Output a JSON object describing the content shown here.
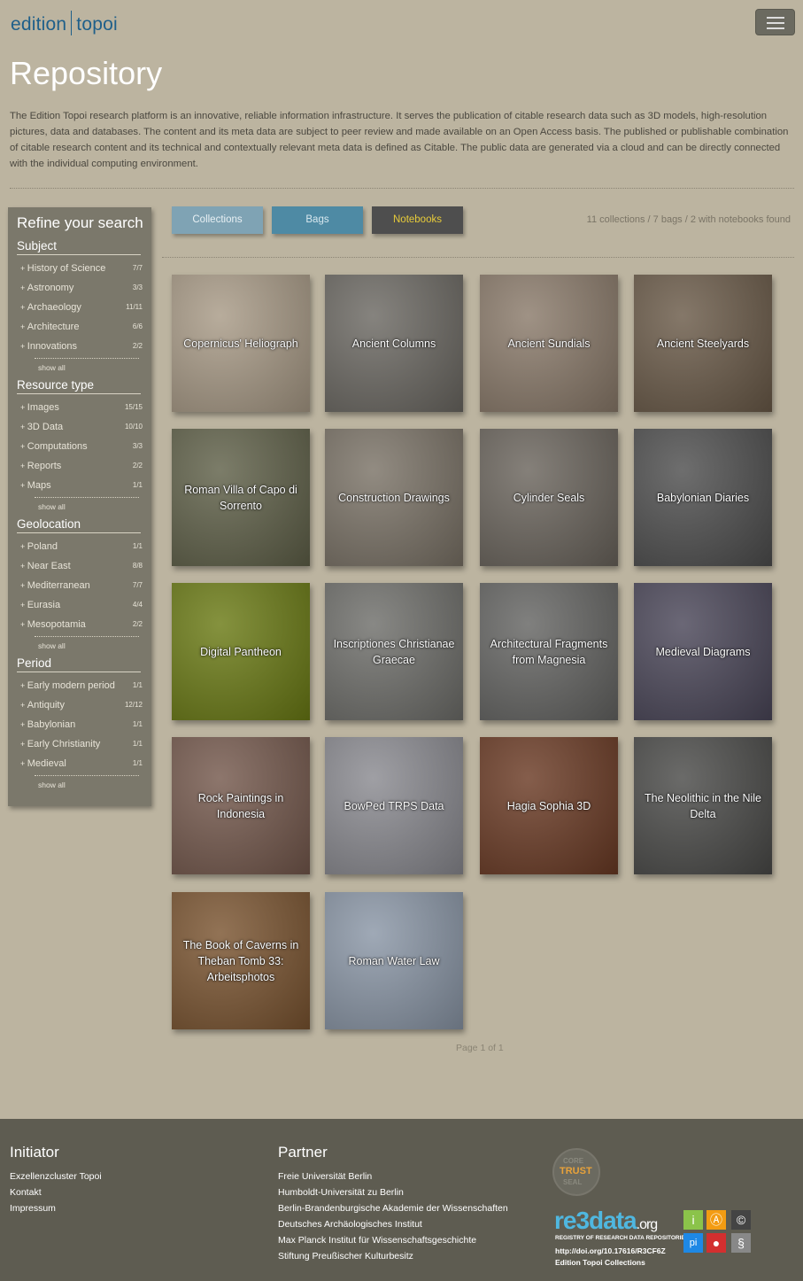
{
  "header": {
    "logo_left": "edition",
    "logo_right": "topoi",
    "menu_icon": "hamburger-icon"
  },
  "page_title": "Repository",
  "intro": "The Edition Topoi research platform is an innovative, reliable information infrastructure. It serves the publication of citable research data such as 3D models, high-resolution pictures, data and databases. The content and its meta data are subject to peer review and made available on an Open Access basis. The published or publishable combination of citable research content and its technical and contextually relevant meta data is defined as Citable. The public data are generated via a cloud and can be directly connected with the individual computing environment.",
  "sidebar": {
    "title": "Refine your search",
    "show_all": "show all",
    "facets": [
      {
        "title": "Subject",
        "items": [
          {
            "label": "History of Science",
            "count": "7/7"
          },
          {
            "label": "Astronomy",
            "count": "3/3"
          },
          {
            "label": "Archaeology",
            "count": "11/11"
          },
          {
            "label": "Architecture",
            "count": "6/6"
          },
          {
            "label": "Innovations",
            "count": "2/2"
          }
        ]
      },
      {
        "title": "Resource type",
        "items": [
          {
            "label": "Images",
            "count": "15/15"
          },
          {
            "label": "3D Data",
            "count": "10/10"
          },
          {
            "label": "Computations",
            "count": "3/3"
          },
          {
            "label": "Reports",
            "count": "2/2"
          },
          {
            "label": "Maps",
            "count": "1/1"
          }
        ]
      },
      {
        "title": "Geolocation",
        "items": [
          {
            "label": "Poland",
            "count": "1/1"
          },
          {
            "label": "Near East",
            "count": "8/8"
          },
          {
            "label": "Mediterranean",
            "count": "7/7"
          },
          {
            "label": "Eurasia",
            "count": "4/4"
          },
          {
            "label": "Mesopotamia",
            "count": "2/2"
          }
        ]
      },
      {
        "title": "Period",
        "items": [
          {
            "label": "Early modern period",
            "count": "1/1"
          },
          {
            "label": "Antiquity",
            "count": "12/12"
          },
          {
            "label": "Babylonian",
            "count": "1/1"
          },
          {
            "label": "Early Christianity",
            "count": "1/1"
          },
          {
            "label": "Medieval",
            "count": "1/1"
          }
        ]
      }
    ]
  },
  "tabs": {
    "collections": "Collections",
    "bags": "Bags",
    "notebooks": "Notebooks"
  },
  "results_count": "11 collections / 7 bags / 2 with notebooks found",
  "tiles": [
    {
      "title": "Copernicus' Heliograph",
      "color": "#a89a86"
    },
    {
      "title": "Ancient Columns",
      "color": "#6b6862"
    },
    {
      "title": "Ancient Sundials",
      "color": "#8a7a6a"
    },
    {
      "title": "Ancient Steelyards",
      "color": "#6a5a48"
    },
    {
      "title": "Roman Villa of Capo di Sorrento",
      "color": "#5f6048"
    },
    {
      "title": "Construction Drawings",
      "color": "#7a7266"
    },
    {
      "title": "Cylinder Seals",
      "color": "#6a645c"
    },
    {
      "title": "Babylonian Diaries",
      "color": "#4e4e4e"
    },
    {
      "title": "Digital Pantheon",
      "color": "#6a7a14"
    },
    {
      "title": "Inscriptiones Christianae Graecae",
      "color": "#6e6e6a"
    },
    {
      "title": "Architectural Fragments from Magnesia",
      "color": "#646462"
    },
    {
      "title": "Medieval Diagrams",
      "color": "#4a4658"
    },
    {
      "title": "Rock Paintings in Indonesia",
      "color": "#74584c"
    },
    {
      "title": "BowPed TRPS Data",
      "color": "#8a8a90"
    },
    {
      "title": "Hagia Sophia 3D",
      "color": "#6a3a24"
    },
    {
      "title": "The Neolithic in the Nile Delta",
      "color": "#4a4a48"
    },
    {
      "title": "The Book of Caverns in Theban Tomb 33: Arbeitsphotos",
      "color": "#7a5430"
    },
    {
      "title": "Roman Water Law",
      "color": "#8a96a6"
    }
  ],
  "pager": "Page 1 of 1",
  "footer": {
    "initiator_title": "Initiator",
    "initiator_links": [
      "Exzellenzcluster Topoi",
      "Kontakt",
      "Impressum"
    ],
    "partner_title": "Partner",
    "partner_links": [
      "Freie Universität Berlin",
      "Humboldt-Universität zu Berlin",
      "Berlin-Brandenburgische Akademie der Wissenschaften",
      "Deutsches Archäologisches Institut",
      "Max Planck Institut für Wissenschaftsgeschichte",
      "Stiftung Preußischer Kulturbesitz"
    ],
    "trust_seal": {
      "line1": "CORE",
      "line2": "TRUST",
      "line3": "SEAL"
    },
    "re3data": {
      "brand": "re3data",
      "tld": ".org",
      "subtitle": "REGISTRY OF RESEARCH DATA REPOSITORIES"
    },
    "doi": "http://doi.org/10.17616/R3CF6Z",
    "doi_label": "Edition Topoi Collections"
  }
}
